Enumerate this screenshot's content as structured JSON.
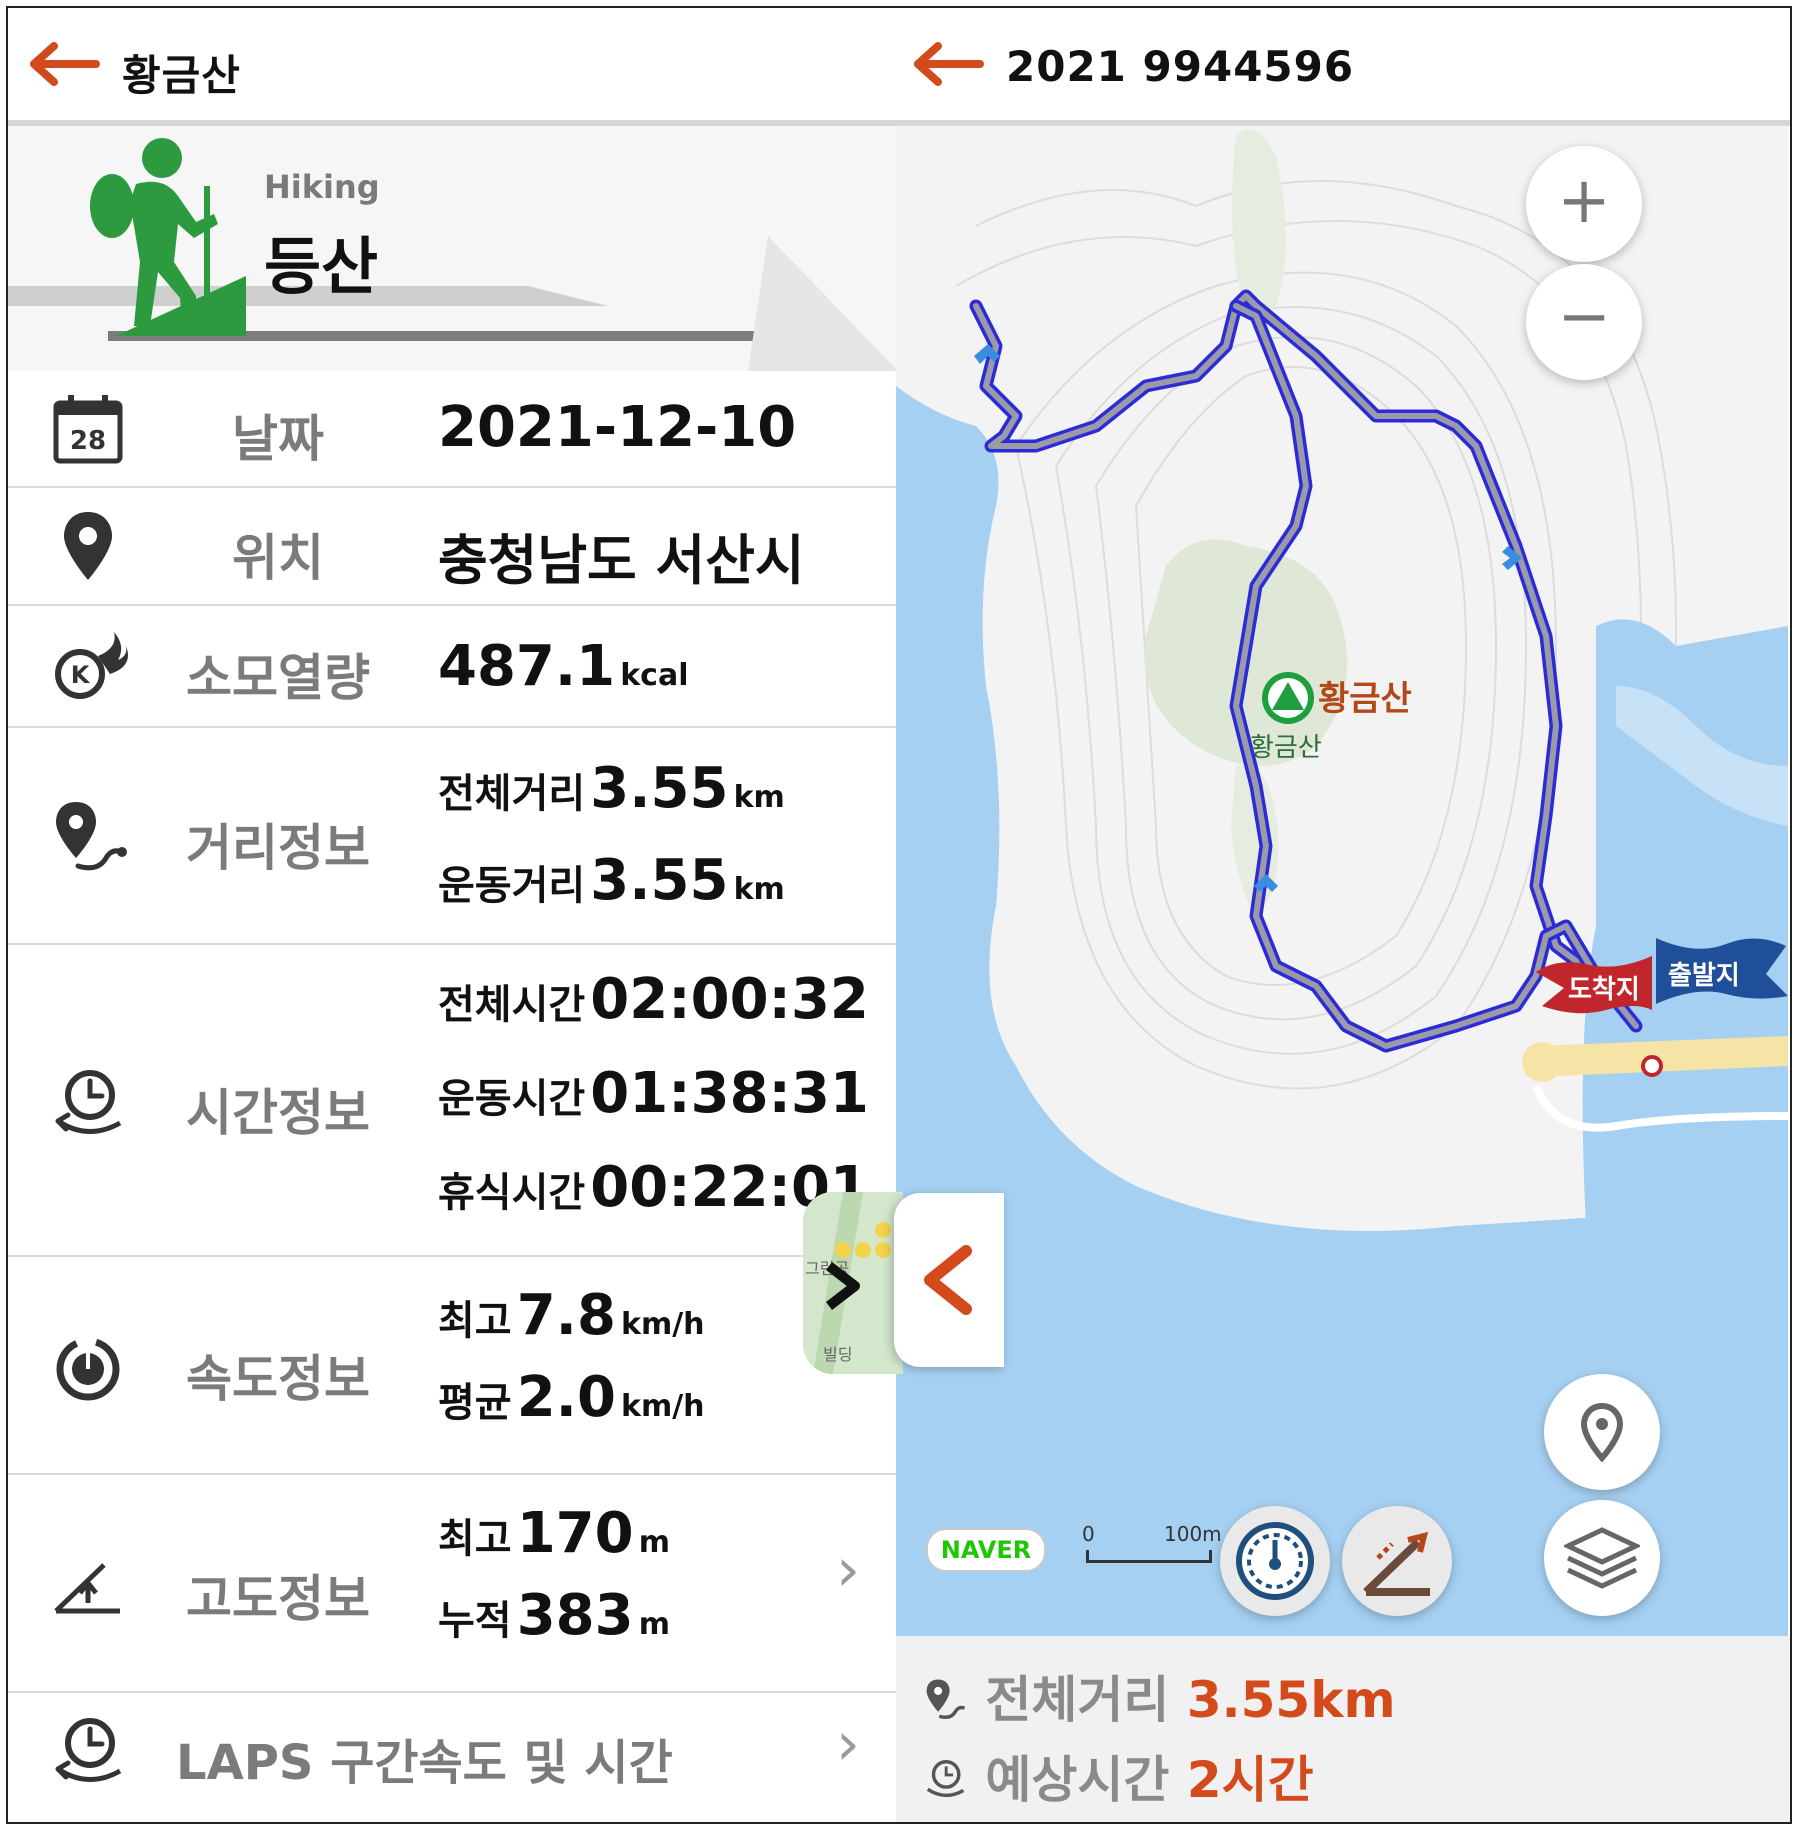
{
  "left_header": {
    "title": "황금산"
  },
  "activity": {
    "en": "Hiking",
    "ko": "등산"
  },
  "rows": {
    "date": {
      "label": "날짜",
      "value": "2021-12-10",
      "icon_day": "28"
    },
    "location": {
      "label": "위치",
      "value": "충청남도 서산시"
    },
    "calories": {
      "label": "소모열량",
      "value": "487.1",
      "unit": "kcal"
    },
    "distance": {
      "label": "거리정보",
      "total_label": "전체거리",
      "total_value": "3.55",
      "total_unit": "km",
      "move_label": "운동거리",
      "move_value": "3.55",
      "move_unit": "km"
    },
    "time": {
      "label": "시간정보",
      "total_label": "전체시간",
      "total_value": "02:00:32",
      "move_label": "운동시간",
      "move_value": "01:38:31",
      "rest_label": "휴식시간",
      "rest_value": "00:22:01"
    },
    "speed": {
      "label": "속도정보",
      "max_label": "최고",
      "max_value": "7.8",
      "max_unit": "km/h",
      "avg_label": "평균",
      "avg_value": "2.0",
      "avg_unit": "km/h"
    },
    "altitude": {
      "label": "고도정보",
      "max_label": "최고",
      "max_value": "170",
      "max_unit": "m",
      "cum_label": "누적",
      "cum_value": "383",
      "cum_unit": "m"
    },
    "laps": {
      "label": "LAPS 구간속도 및 시간"
    }
  },
  "right_header": {
    "title": "2021 9944596"
  },
  "map": {
    "zoom_in": "+",
    "zoom_out": "−",
    "peak_label": "황금산",
    "peak_label_small": "황금산",
    "start_flag": "출발지",
    "end_flag": "도착지",
    "naver": "NAVER",
    "scale_zero": "0",
    "scale_max": "100m",
    "thumb_label_1": "그린공",
    "thumb_label_2": "빌딩"
  },
  "summary": {
    "total_label": "전체거리",
    "total_value": "3.55km",
    "est_label": "예상시간",
    "est_value": "2시간"
  },
  "colors": {
    "accent": "#d34a1c",
    "hiker_green": "#2e9a3f",
    "route": "#2b2bd8",
    "start_flag": "#1f4f99",
    "end_flag": "#c0262c"
  }
}
